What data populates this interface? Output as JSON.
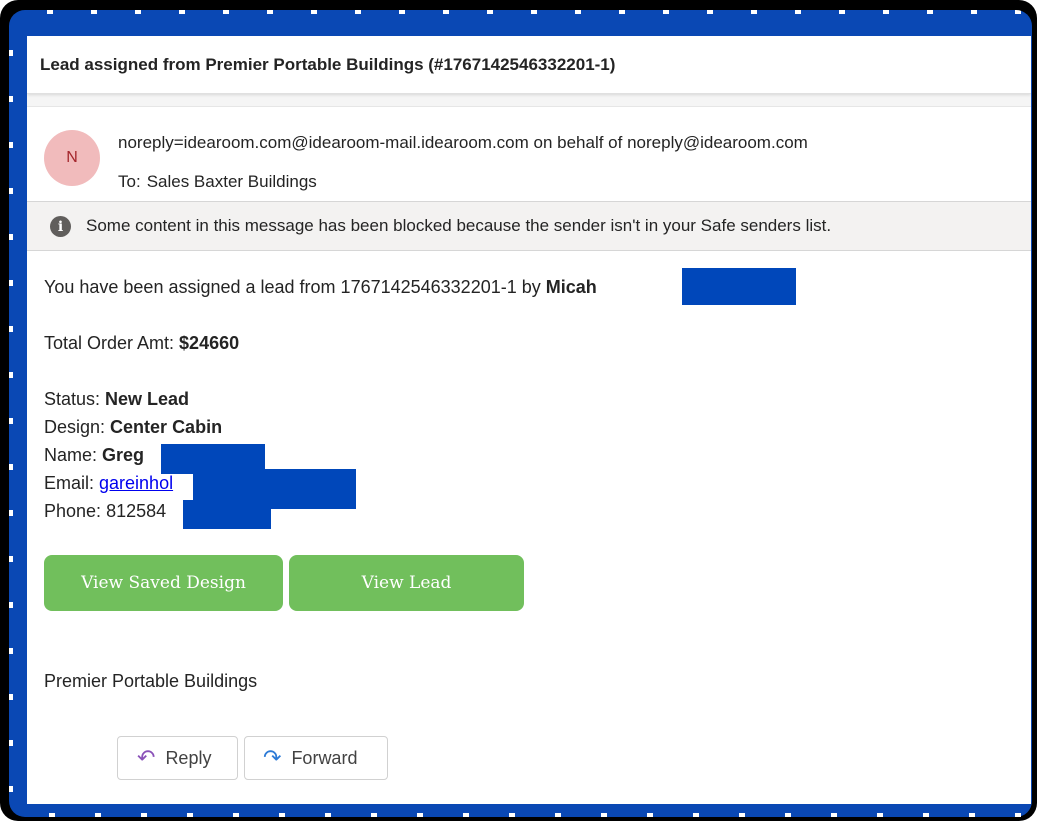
{
  "subject": "Lead assigned from Premier Portable Buildings (#1767142546332201-1)",
  "sender": {
    "avatar_initial": "N",
    "from": "noreply=idearoom.com@idearoom-mail.idearoom.com on behalf of noreply@idearoom.com",
    "to_label": "To:",
    "to_value": "Sales Baxter Buildings"
  },
  "blocked_notice": {
    "icon": "info-icon",
    "text": "Some content in this message has been blocked because the sender isn't in your Safe senders list."
  },
  "body": {
    "assigned_prefix": "You have been assigned a lead from 1767142546332201-1 by ",
    "assigned_by": "Micah",
    "total_label": "Total Order Amt: ",
    "total_value": "$24660",
    "status_label": "Status: ",
    "status_value": "New Lead",
    "design_label": "Design: ",
    "design_value": "Center Cabin",
    "name_label": "Name: ",
    "name_value": "Greg",
    "email_label": "Email: ",
    "email_value": "gareinhol",
    "phone_label": "Phone: ",
    "phone_value": "812584",
    "signature": "Premier Portable Buildings"
  },
  "buttons": {
    "view_saved_design": "View Saved Design",
    "view_lead": "View Lead"
  },
  "actions": {
    "reply": "Reply",
    "forward": "Forward",
    "reply_icon": "reply-arrow-icon",
    "forward_icon": "forward-arrow-icon"
  },
  "colors": {
    "frame": "#0a48b4",
    "button_green": "#71bf5c",
    "redaction": "#0047ba",
    "avatar_bg": "#f1bbbc"
  }
}
